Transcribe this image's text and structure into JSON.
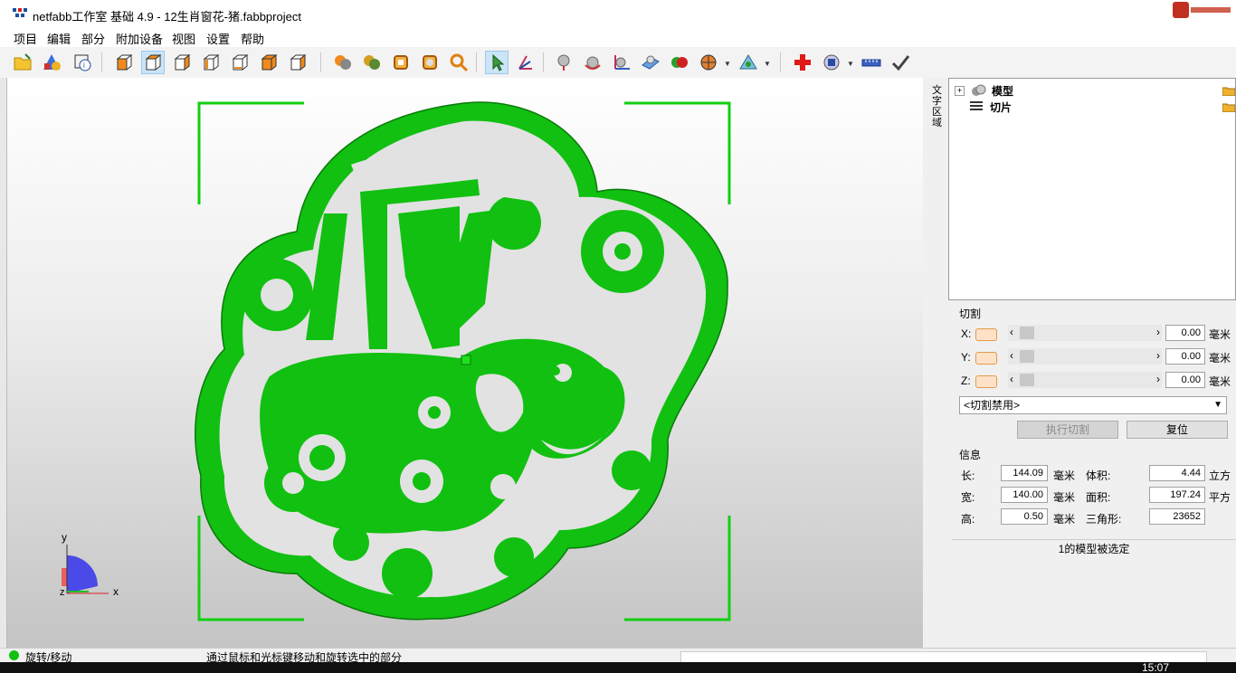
{
  "window": {
    "title": "netfabb工作室 基础 4.9 - 12生肖窗花-猪.fabbproject"
  },
  "menu": [
    "项目",
    "编辑",
    "部分",
    "附加设备",
    "视图",
    "设置",
    "帮助"
  ],
  "toolbar": {
    "icons": [
      "open-project-icon",
      "add-part-icon",
      "part-info-icon",
      "view-front-icon",
      "view-back-icon",
      "view-left-icon",
      "view-right-icon",
      "view-top-icon",
      "view-bottom-icon",
      "view-iso-icon",
      "color-parts-icon",
      "color-textures-icon",
      "wireframe-icon",
      "slice-view-icon",
      "zoom-icon",
      "select-cursor-icon",
      "move-axis-icon",
      "center-icon",
      "rotate-icon",
      "axes-icon",
      "measure-plane-icon",
      "color-mode-icon",
      "shading-icon",
      "light-icon",
      "repair-icon",
      "camera-icon",
      "ruler-icon",
      "confirm-check-icon"
    ]
  },
  "viewport": {
    "axis": {
      "y": "y",
      "x": "x",
      "z": "z"
    },
    "colors": {
      "model": "#11c011",
      "frame": "#10d010"
    }
  },
  "side_tab": {
    "label": "文字区域"
  },
  "tree": {
    "items": [
      {
        "label": "模型",
        "icon": "models-icon"
      },
      {
        "label": "切片",
        "icon": "slices-icon"
      }
    ]
  },
  "cut": {
    "section_title": "切割",
    "axes": [
      {
        "label": "X:",
        "value": "0.00",
        "unit": "毫米"
      },
      {
        "label": "Y:",
        "value": "0.00",
        "unit": "毫米"
      },
      {
        "label": "Z:",
        "value": "0.00",
        "unit": "毫米"
      }
    ],
    "mode_select": "<切割禁用>",
    "execute_button": "执行切割",
    "reset_button": "复位"
  },
  "info": {
    "section_title": "信息",
    "rows": [
      {
        "l1": "长:",
        "v1": "144.09",
        "u1": "毫米",
        "l2": "体积:",
        "v2": "4.44",
        "u2": "立方"
      },
      {
        "l1": "宽:",
        "v1": "140.00",
        "u1": "毫米",
        "l2": "面积:",
        "v2": "197.24",
        "u2": "平方"
      },
      {
        "l1": "高:",
        "v1": "0.50",
        "u1": "毫米",
        "l2": "三角形:",
        "v2": "23652",
        "u2": ""
      }
    ],
    "selection_status": "1的模型被选定"
  },
  "statusbar": {
    "mode": "旋转/移动",
    "hint": "通过鼠标和光标键移动和旋转选中的部分"
  },
  "taskbar": {
    "time": "15:07"
  }
}
